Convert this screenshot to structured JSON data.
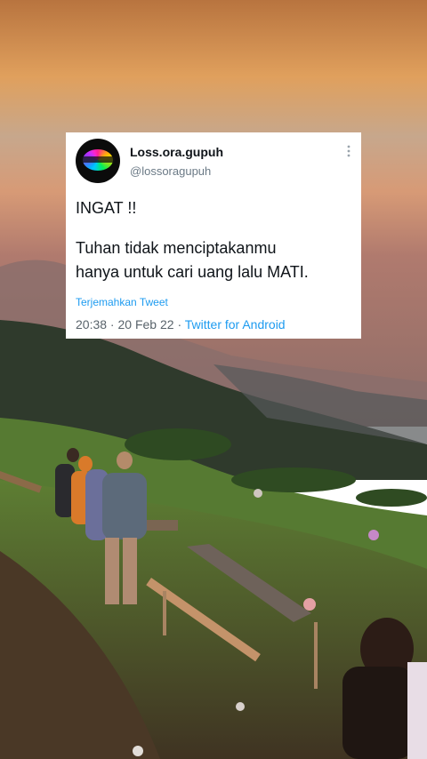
{
  "tweet": {
    "display_name": "Loss.ora.gupuh",
    "handle": "@lossoragupuh",
    "line1": "INGAT !!",
    "line2": "Tuhan tidak menciptakanmu",
    "line3": "hanya untuk cari uang lalu MATI.",
    "translate_label": "Terjemahkan Tweet",
    "time": "20:38",
    "separator1": " · ",
    "date": "20 Feb 22",
    "separator2": " · ",
    "source": "Twitter for Android"
  },
  "icons": {
    "more": "more-vertical-icon",
    "avatar": "avatar-logo"
  },
  "colors": {
    "link": "#1d9bf0",
    "sky_top": "#c98a52",
    "sky_mid": "#e6a867",
    "hill": "#2e3a2c",
    "grass": "#4f7a2e",
    "soil": "#5a4030"
  }
}
